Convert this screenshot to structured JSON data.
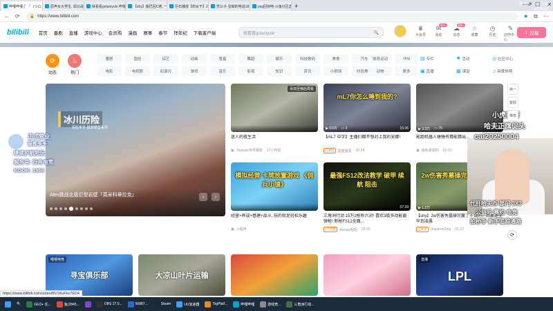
{
  "browser": {
    "tabs": [
      {
        "title": "哔哩哔哩 (゜-゜)つロ 干杯~-bilibili",
        "active": true
      },
      {
        "title": "原声女大学生, 闺马战现在的大学",
        "active": false
      },
      {
        "title": "就看看golaniyule 哔哩哔哩_bilibili",
        "active": false
      },
      {
        "title": "【shy】脑巴回C佬, 一般不做, 不...",
        "active": false
      },
      {
        "title": "巨石播放【织女干】2027最新的...",
        "active": false
      },
      {
        "title": "凭公子-宝呦的电话18岁即将...",
        "active": false
      },
      {
        "title": "psg回快吧-斗鱼社区直播频道",
        "active": false
      }
    ],
    "url": "https://www.bilibili.com",
    "status_url": "https://www.bilibili.com/video/BV1KuFkz7ED4"
  },
  "header": {
    "logo": "bilibili",
    "nav": [
      "首页",
      "番剧",
      "直播",
      "游戏中心",
      "会员购",
      "漫画",
      "赛事",
      "春节",
      "拜年纪",
      "下载客户端"
    ],
    "search_placeholder": "就看看golaniyule",
    "right_items": [
      {
        "label": "大会员",
        "icon": "crown-icon"
      },
      {
        "label": "消息",
        "icon": "message-icon",
        "badge": "99+"
      },
      {
        "label": "动态",
        "icon": "wind-icon",
        "badge": "99+"
      },
      {
        "label": "收藏",
        "icon": "star-icon"
      },
      {
        "label": "历史",
        "icon": "clock-icon"
      },
      {
        "label": "创作中心",
        "icon": "bulb-icon"
      }
    ],
    "upload_label": "投稿"
  },
  "channels": {
    "main_icons": [
      {
        "label": "动态",
        "color": "#ff9212"
      },
      {
        "label": "热门",
        "color": "#f07775"
      }
    ],
    "grid": [
      "番剧",
      "国创",
      "综艺",
      "动画",
      "鬼畜",
      "舞蹈",
      "娱乐",
      "科技数码",
      "美食",
      "汽车",
      "电影",
      "电视剧",
      "纪录片",
      "游戏",
      "音乐",
      "影视",
      "知识",
      "资讯",
      "小剧场",
      "时尚美妆"
    ],
    "extra": [
      "体育运动",
      "vlog",
      "动物",
      "更多"
    ],
    "right": [
      {
        "label": "专栏",
        "icon": "doc-icon"
      },
      {
        "label": "活动",
        "icon": "flag-icon"
      },
      {
        "label": "社区中心",
        "icon": "globe-icon"
      },
      {
        "label": "直播",
        "icon": "tv-icon"
      },
      {
        "label": "课堂",
        "icon": "class-icon"
      },
      {
        "label": "新歌热榜",
        "icon": "music-icon"
      }
    ]
  },
  "carousel": {
    "title": "Alex挑战北极巨型岩壁「英米科蒂拉克」",
    "logo_text": "冰川历险",
    "logo_sub": "探险世界·震撼攀登系列",
    "slide_count": 9,
    "active_slide": 4
  },
  "cards_row1": [
    {
      "title": "迷人的夜生活",
      "author": "Youtube世界播放",
      "time": "17小时前",
      "views": "",
      "comments": "",
      "duration": "",
      "overlay": "添加至稍后再看",
      "tag": "",
      "bg": "linear-gradient(150deg,#6d7a5c,#b5b7a8,#3f4538)"
    },
    {
      "title": "【mL7 中字】主播们都不想对上我的安娜!",
      "author": "雷霆猴源",
      "time": "02-04",
      "views": "6315",
      "comments": "3",
      "duration": "15:36",
      "overlay": "mL7你怎么睡到我的?",
      "tag": "已关注",
      "bg": "linear-gradient(150deg,#3a3f55,#7e8596,#2d2f3c)"
    },
    {
      "title": "能跑机器人锤锤有猜能猜出...",
      "author": "极色悬疑的",
      "time": "02-01",
      "views": "3.3万",
      "comments": "75",
      "duration": "06:15",
      "overlay": "",
      "tag": "",
      "bg": "linear-gradient(150deg,#545454,#8a8a8a,#2c2c2c)"
    },
    {
      "title": "经营+养成+基建+战斗, 玩的就是轻松乐趣",
      "author": "小程序",
      "time": "",
      "views": "",
      "comments": "",
      "duration": "",
      "overlay": "模拟经营 卡牌放置游戏 《佣兵小镇》",
      "tag": "",
      "bg": "linear-gradient(150deg,#3da2d8,#7cd2f5,#2d7fb8)"
    },
    {
      "title": "三角洲行动 15万2枪秒六对! 喜欢3级多动能霰弹枪! 新枪FS12全面...",
      "author": "Always昭昭",
      "time": "02-05",
      "views": "",
      "comments": "",
      "duration": "07:39",
      "overlay": "最强FS12改法教学 破甲 续航 阻击",
      "tag": "1万点赞",
      "bg": "linear-gradient(150deg,#111,#2a3a1a,#000)"
    },
    {
      "title": "【shy】2w伤害秀墓操完赢了不错的，后果是坐牢到凌晨",
      "author": "UniverseSing",
      "time": "01-22",
      "views": "1.2万",
      "comments": "",
      "duration": "",
      "overlay": "2w伤害秀墓操完赢了不错的",
      "tag": "已关注",
      "bg": "linear-gradient(150deg,#4b6a45,#8a9b6a,#37452a)"
    }
  ],
  "cards_row2": [
    {
      "title": "寻宝俱乐部",
      "bg": "linear-gradient(150deg,#2b63b8,#4f97e0,#1b3f7a)",
      "overlay": "寻宝俱乐部",
      "badge": "嘻嘻电竞"
    },
    {
      "title": "大凉山叶片运输",
      "bg": "linear-gradient(150deg,#7b8a6a,#a8a89a,#4a4f3a)",
      "overlay": "大凉山叶片运输",
      "badge": ""
    },
    {
      "title": "",
      "bg": "linear-gradient(150deg,#d94a3a,#f2a23a,#2aa36a)",
      "overlay": "",
      "badge": ""
    },
    {
      "title": "",
      "bg": "linear-gradient(150deg,#f2a0c0,#ffd0e0,#d0708a)",
      "overlay": "",
      "badge": ""
    },
    {
      "title": "LPL",
      "bg": "linear-gradient(150deg,#0f1f4a,#2a4a9a,#091530)",
      "overlay": "LPL",
      "badge": "直播"
    }
  ],
  "overlays": {
    "left_lines": [
      "正式营业",
      "猫都多多",
      "继续护航陪玩",
      "服务号: 行舟电竞",
      "KOOK: 1868"
    ],
    "right_lines": [
      "小虎行行",
      "哈夫正旗促头",
      "cai20250004",
      "代肝哈夫币 部门 3X3",
      "公益号 赛约 电竞",
      "拍桥手 新手追踪通路"
    ]
  },
  "side_buttons": [
    "换一换",
    "客服",
    "推荐"
  ],
  "taskbar": {
    "items": [
      "GEO+ 任...",
      "鱼(2845...",
      "",
      "OBS 27.0...",
      "56887...",
      "Steam",
      "UU加速器",
      "TsgPlaif...",
      "哔哩哔哩",
      "游戏竞...",
      "三角洲行动..."
    ],
    "time": "7:58",
    "date": "2026/2/7",
    "ime": "英"
  }
}
